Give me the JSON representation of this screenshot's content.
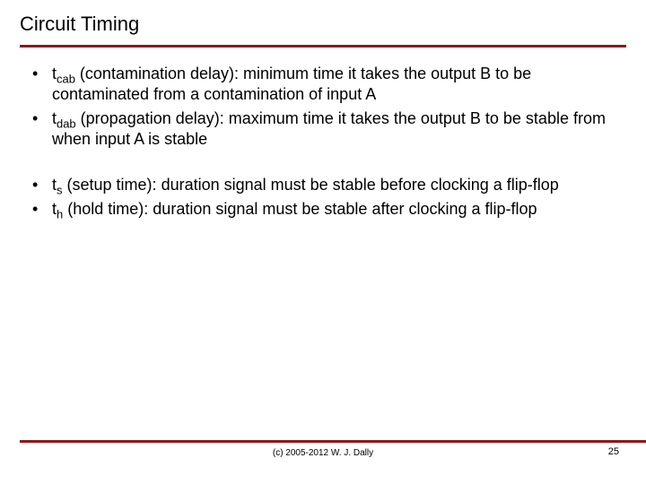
{
  "title": "Circuit Timing",
  "bullets_group1": [
    {
      "sym": "t",
      "sub": "cab",
      "label": "(contamination delay)",
      "desc": "minimum time it takes the output B to be contaminated from a contamination of input A"
    },
    {
      "sym": "t",
      "sub": "dab",
      "label": "(propagation delay)",
      "desc": "maximum time it takes the output B to be stable from when input A is stable"
    }
  ],
  "bullets_group2": [
    {
      "sym": "t",
      "sub": "s",
      "label": "(setup time)",
      "desc": "duration signal must be stable before clocking a flip-flop"
    },
    {
      "sym": "t",
      "sub": "h",
      "label": "(hold time)",
      "desc": "duration signal must be stable after clocking a flip-flop"
    }
  ],
  "copyright": "(c) 2005-2012 W. J. Dally",
  "page_number": "25"
}
